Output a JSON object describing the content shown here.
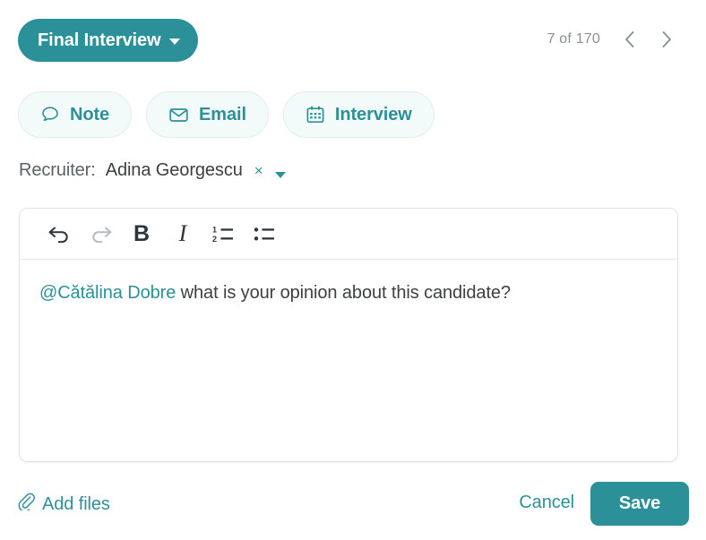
{
  "header": {
    "stage_button": {
      "label": "Final Interview",
      "icon": "chevron-down-icon",
      "background": "#2c9099",
      "text_color": "#ffffff"
    },
    "pager": {
      "count_text": "7 of 170",
      "current": 7,
      "total": 170,
      "prev_icon": "chevron-left-icon",
      "next_icon": "chevron-right-icon",
      "text_color": "#8a9196"
    }
  },
  "activity_tabs": [
    {
      "label": "Note",
      "icon": "speech-bubble-icon",
      "selected": false
    },
    {
      "label": "Email",
      "icon": "envelope-icon",
      "selected": false
    },
    {
      "label": "Interview",
      "icon": "calendar-icon",
      "selected": false
    }
  ],
  "recruiter": {
    "label": "Recruiter:",
    "value": "Adina Georgescu",
    "clear_label": "×",
    "clear_icon": "close-icon",
    "dropdown_icon": "chevron-down-icon"
  },
  "editor": {
    "toolbar": [
      {
        "name": "undo",
        "icon": "undo-arrow-icon",
        "label": "↩",
        "enabled": true
      },
      {
        "name": "redo",
        "icon": "redo-arrow-icon",
        "label": "↪",
        "enabled": false
      },
      {
        "name": "bold",
        "icon": "bold-icon",
        "label": "B",
        "enabled": true
      },
      {
        "name": "italic",
        "icon": "italic-icon",
        "label": "I",
        "enabled": true
      },
      {
        "name": "ordered-list",
        "icon": "ordered-list-icon",
        "label": "",
        "enabled": true
      },
      {
        "name": "bullet-list",
        "icon": "bullet-list-icon",
        "label": "",
        "enabled": true
      }
    ],
    "content": {
      "mention": "@Cătălina Dobre",
      "text": " what is your opinion about this candidate?"
    }
  },
  "footer": {
    "add_files_label": "Add files",
    "add_files_icon": "paperclip-icon",
    "cancel_label": "Cancel",
    "save_label": "Save"
  },
  "colors": {
    "accent": "#2c9099",
    "tab_background": "#f3fafa",
    "tab_border": "#e2edee",
    "muted_text": "#8a9196",
    "body_text": "#3b4043",
    "editor_border": "#dfe3e5"
  }
}
